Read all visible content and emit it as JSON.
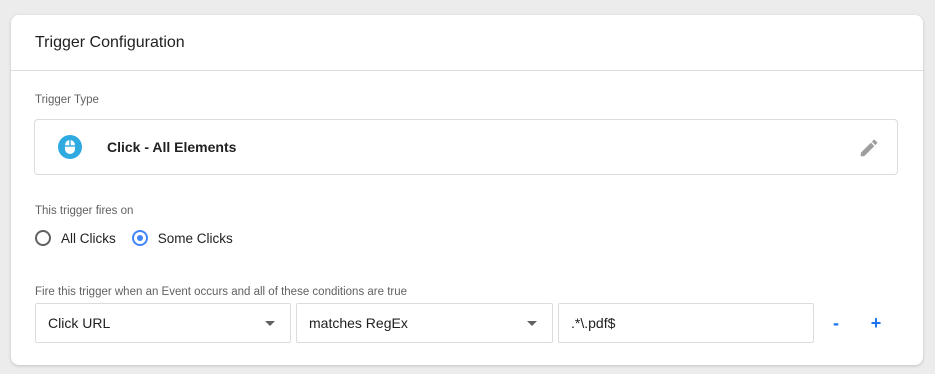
{
  "card": {
    "title": "Trigger Configuration"
  },
  "trigger_type": {
    "label": "Trigger Type",
    "name": "Click - All Elements",
    "icon": "mouse-icon",
    "icon_color": "#2eaae1"
  },
  "fires_on": {
    "label": "This trigger fires on",
    "options": [
      {
        "label": "All Clicks",
        "selected": false
      },
      {
        "label": "Some Clicks",
        "selected": true
      }
    ],
    "accent": "#4285f4"
  },
  "conditions": {
    "label": "Fire this trigger when an Event occurs and all of these conditions are true",
    "variable": "Click URL",
    "operator": "matches RegEx",
    "value": ".*\\.pdf$",
    "remove_label": "-",
    "add_label": "+",
    "button_color": "#1a73e8"
  }
}
